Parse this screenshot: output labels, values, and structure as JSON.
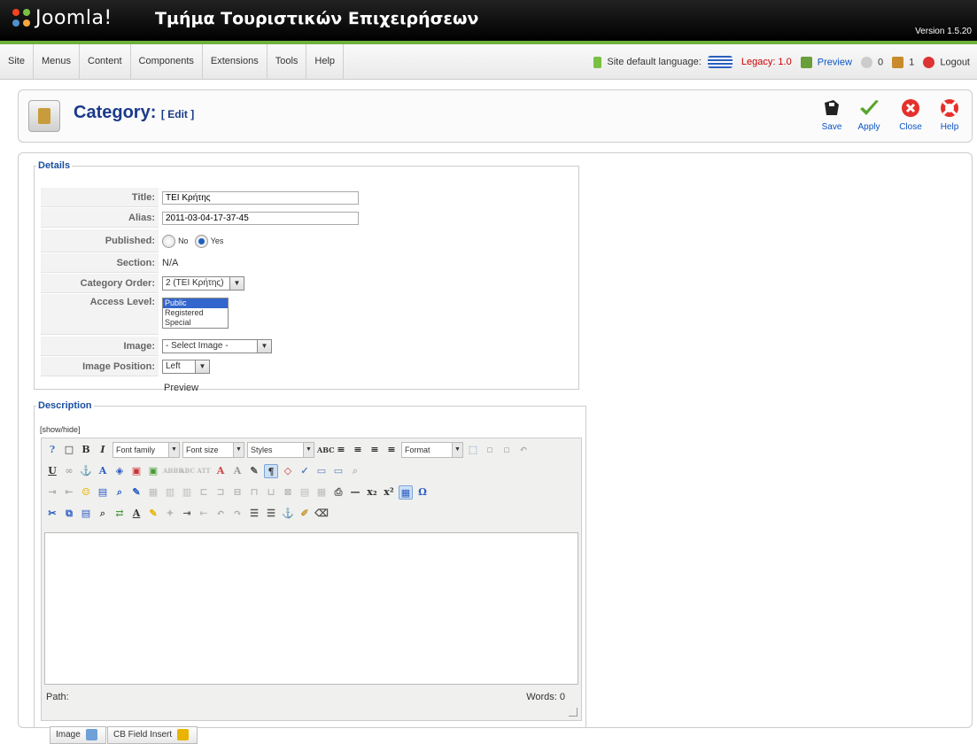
{
  "header": {
    "brand": "Joomla!",
    "site_name": "Τμήμα Τουριστικών Επιχειρήσεων",
    "version": "Version 1.5.20"
  },
  "menu": {
    "items": [
      "Site",
      "Menus",
      "Content",
      "Components",
      "Extensions",
      "Tools",
      "Help"
    ],
    "language_label": "Site default language:",
    "legacy": "Legacy: 1.0",
    "preview": "Preview",
    "messages_count": "0",
    "users_count": "1",
    "logout": "Logout"
  },
  "toolbar": {
    "title": "Category:",
    "subtitle": "[ Edit ]",
    "buttons": [
      "Save",
      "Apply",
      "Close",
      "Help"
    ]
  },
  "details": {
    "legend": "Details",
    "title_label": "Title:",
    "title_value": "TEI Κρήτης",
    "alias_label": "Alias:",
    "alias_value": "2011-03-04-17-37-45",
    "published_label": "Published:",
    "published_no": "No",
    "published_yes": "Yes",
    "section_label": "Section:",
    "section_value": "N/A",
    "order_label": "Category Order:",
    "order_value": "2 (TEI Κρήτης)",
    "access_label": "Access Level:",
    "access_options": [
      "Public",
      "Registered",
      "Special"
    ],
    "access_selected": "Public",
    "image_label": "Image:",
    "image_value": "- Select Image -",
    "image_pos_label": "Image Position:",
    "image_pos_value": "Left",
    "preview_text": "Preview"
  },
  "description": {
    "legend": "Description",
    "show_hide": "[show/hide]",
    "font_family": "Font family",
    "font_size": "Font size",
    "styles": "Styles",
    "format": "Format",
    "path_label": "Path:",
    "words_label": "Words: 0",
    "buttons": [
      "Image",
      "CB Field Insert"
    ]
  }
}
